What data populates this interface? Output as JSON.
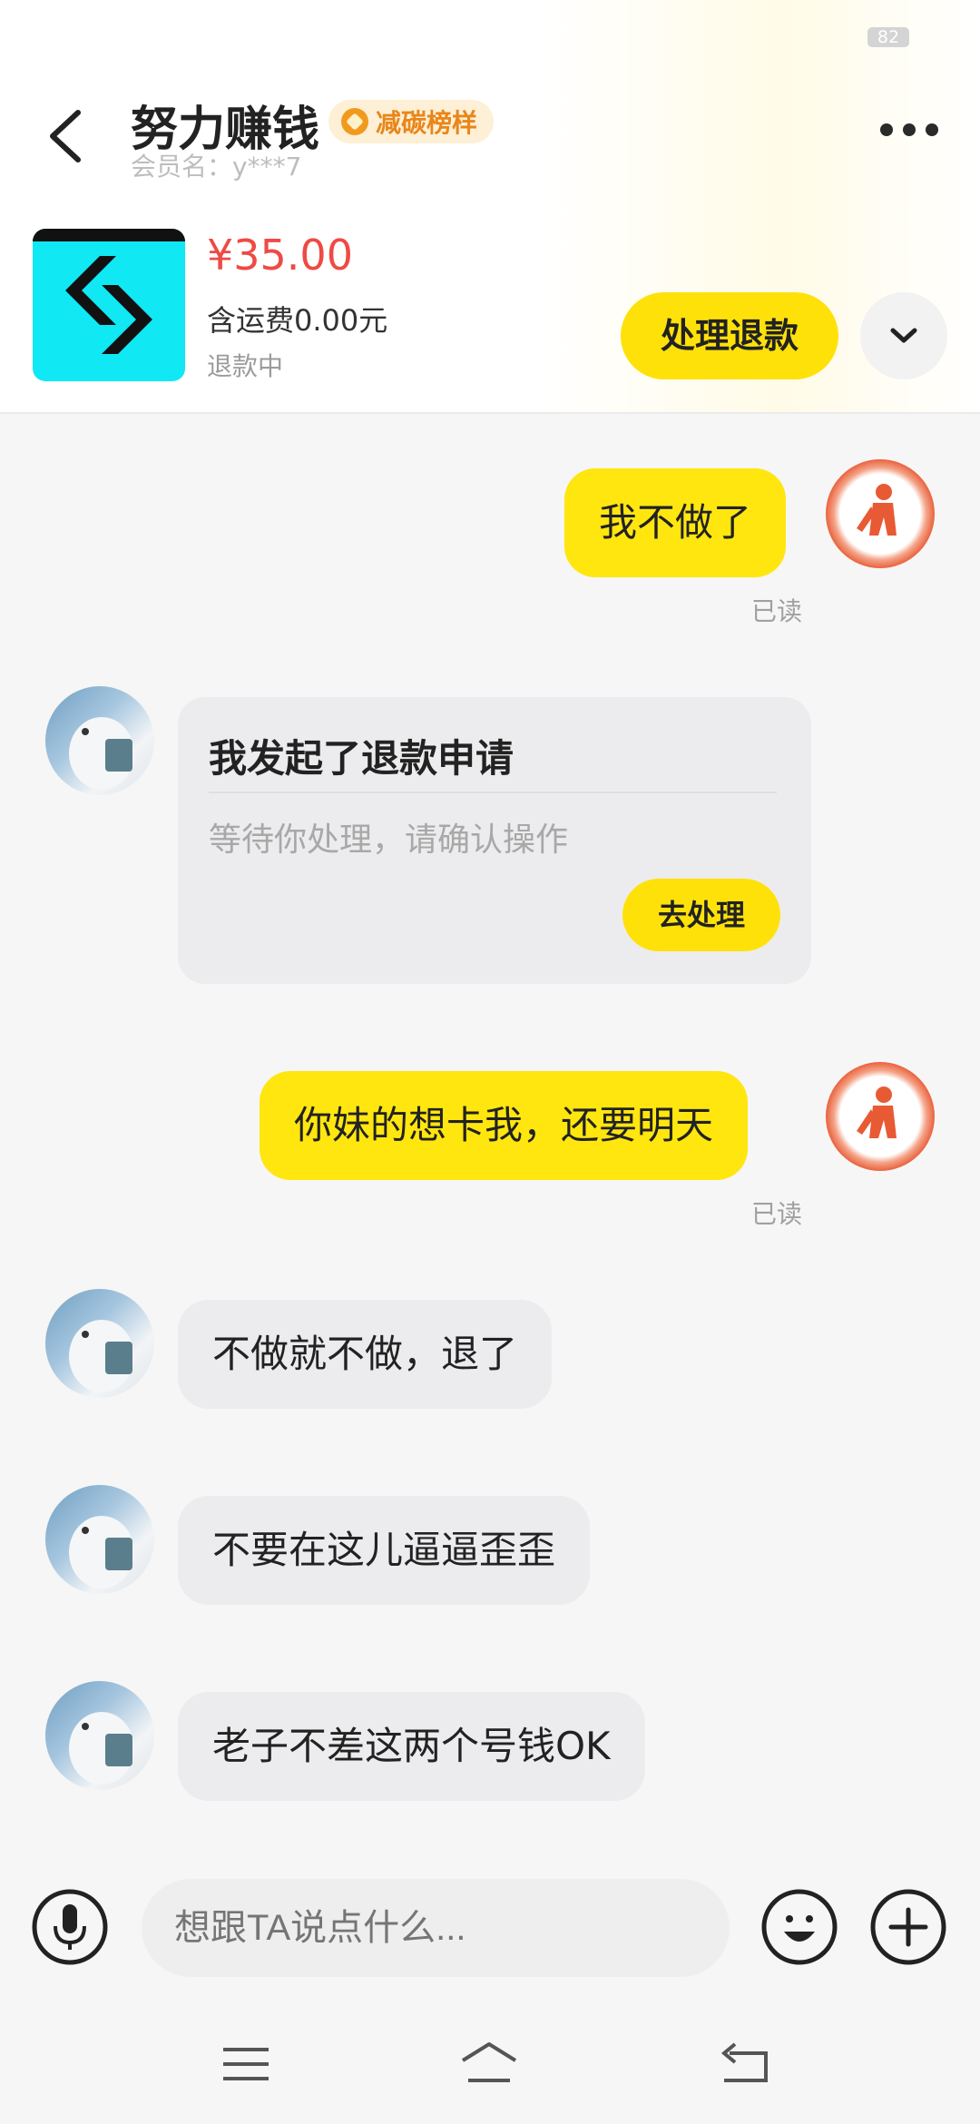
{
  "status_bar": {
    "battery": "82"
  },
  "header": {
    "title": "努力赚钱",
    "badge": "减碳榜样",
    "member": "会员名：y***7"
  },
  "order": {
    "price": "¥35.00",
    "shipping": "含运费0.00元",
    "status": "退款中",
    "refund_button": "处理退款"
  },
  "messages": {
    "m1": "我不做了",
    "m1_read": "已读",
    "card_title": "我发起了退款申请",
    "card_desc": "等待你处理，请确认操作",
    "card_button": "去处理",
    "m2": "你妹的想卡我，还要明天",
    "m2_read": "已读",
    "m3": "不做就不做，退了",
    "m4": "不要在这儿逼逼歪歪",
    "m5": "老子不差这两个号钱OK"
  },
  "input": {
    "placeholder": "想跟TA说点什么..."
  },
  "icons": {
    "back": "chevron-left-icon",
    "more": "more-dots-icon",
    "expand": "chevron-down-icon",
    "mic": "microphone-icon",
    "emoji": "smiley-icon",
    "plus": "plus-icon",
    "nav_menu": "menu-icon",
    "nav_home": "home-icon",
    "nav_back": "back-arrow-icon"
  },
  "colors": {
    "accent_yellow": "#ffe10a",
    "price_red": "#ef4a44",
    "badge_orange": "#e9861a"
  }
}
